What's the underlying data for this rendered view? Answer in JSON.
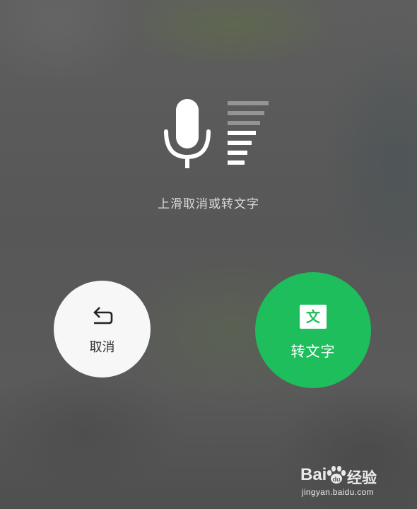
{
  "voice_input": {
    "hint": "上滑取消或转文字",
    "volume_level_bars": 7,
    "volume_bars_active": 4
  },
  "actions": {
    "cancel": {
      "label": "取消",
      "icon": "undo-icon"
    },
    "convert": {
      "label": "转文字",
      "icon_text": "文",
      "icon": "text-icon"
    }
  },
  "watermark": {
    "brand_bai": "Bai",
    "brand_jy": "经验",
    "url": "jingyan.baidu.com"
  },
  "colors": {
    "accent_green": "#1fbe5c",
    "cancel_bg": "#f7f7f7",
    "overlay": "#585858"
  }
}
